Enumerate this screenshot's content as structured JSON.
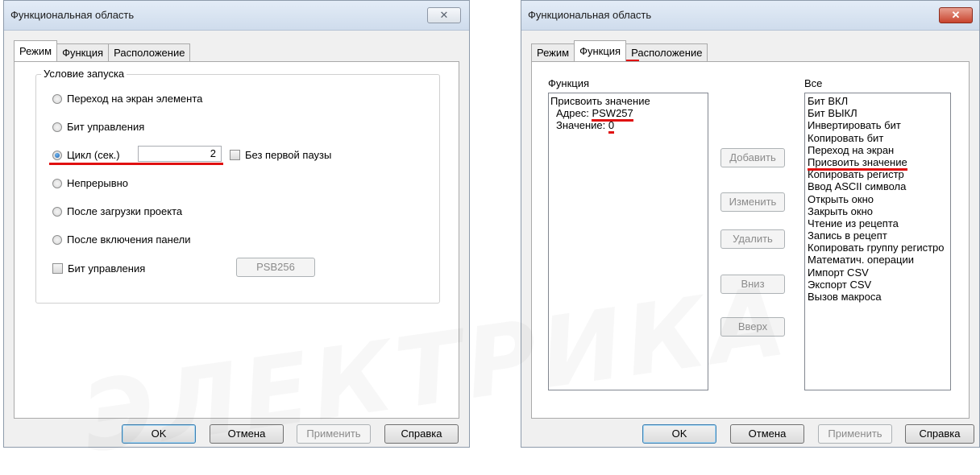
{
  "dialog1": {
    "title": "Функциональная область",
    "close_glyph": "✕",
    "tabs": [
      "Режим",
      "Функция",
      "Расположение"
    ],
    "group_label": "Условие запуска",
    "options": [
      "Переход на экран элемента",
      "Бит управления",
      "Цикл (сек.)",
      "Непрерывно",
      "После загрузки проекта",
      "После включения панели"
    ],
    "selected_option": "Цикл (сек.)",
    "cycle_value": "2",
    "no_first_pause_label": "Без первой паузы",
    "control_bit_checkbox_label": "Бит управления",
    "control_bit_address": "PSB256",
    "buttons": {
      "ok": "OK",
      "cancel": "Отмена",
      "apply": "Применить",
      "help": "Справка"
    }
  },
  "dialog2": {
    "title": "Функциональная область",
    "close_glyph": "✕",
    "tabs": [
      "Режим",
      "Функция",
      "Расположение"
    ],
    "function_label": "Функция",
    "function_list": {
      "line1": "Присвоить значение",
      "address_label": "Адрес:",
      "address_value": "PSW257",
      "value_label": "Значение:",
      "value_value": "0"
    },
    "action_buttons": {
      "add": "Добавить",
      "edit": "Изменить",
      "delete": "Удалить",
      "down": "Вниз",
      "up": "Вверх"
    },
    "all_label": "Все",
    "all_items": [
      "Бит ВКЛ",
      "Бит ВЫКЛ",
      "Инвертировать бит",
      "Копировать бит",
      "Переход на экран",
      "Присвоить значение",
      "Копировать регистр",
      "Ввод ASCII символа",
      "Открыть окно",
      "Закрыть окно",
      "Чтение из рецепта",
      "Запись в рецепт",
      "Копировать группу регистро",
      "Математич. операции",
      "Импорт CSV",
      "Экспорт CSV",
      "Вызов макроса"
    ],
    "highlighted_item": "Присвоить значение",
    "buttons": {
      "ok": "OK",
      "cancel": "Отмена",
      "apply": "Применить",
      "help": "Справка"
    }
  },
  "watermark": "ЭЛЕКТРИКА",
  "colors": {
    "accent_red": "#e01010",
    "titlebar": "#d6e2f0",
    "dialog_bg": "#f0f0f0"
  }
}
